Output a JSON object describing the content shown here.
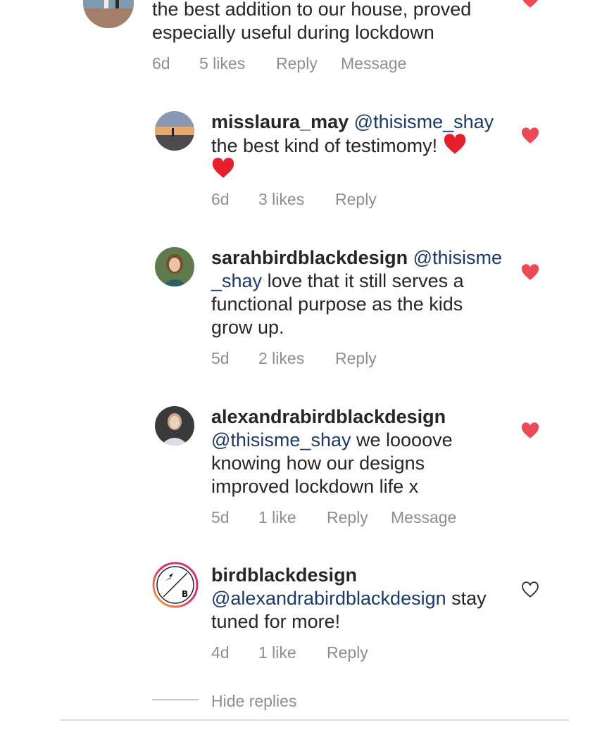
{
  "top_comment": {
    "text": "the best addition to our house, proved especially useful during lockdown",
    "time": "6d",
    "likes": "5 likes",
    "reply": "Reply",
    "message": "Message"
  },
  "replies": [
    {
      "username": "misslaura_may",
      "mention": "@thisisme_shay",
      "text": "the best kind of testimomy!",
      "time": "6d",
      "likes": "3 likes",
      "reply": "Reply",
      "liked": true
    },
    {
      "username": "sarahbirdblackdesign",
      "mention_part1": "@thisisme",
      "mention_part2": "_shay",
      "text_line1": "love that it still serves a",
      "text_line2": "functional purpose as the kids",
      "text_line3": "grow up.",
      "time": "5d",
      "likes": "2 likes",
      "reply": "Reply",
      "liked": true
    },
    {
      "username": "alexandrabirdblackdesign",
      "mention": "@thisisme_shay",
      "text_line1": "we loooove",
      "text_line2": "knowing how our designs",
      "text_line3": "improved lockdown life x",
      "time": "5d",
      "likes": "1 like",
      "reply": "Reply",
      "message": "Message",
      "liked": true
    },
    {
      "username": "birdblackdesign",
      "mention": "@alexandrabirdblackdesign",
      "text_line1": "stay",
      "text_line2": "tuned for more!",
      "time": "4d",
      "likes": "1 like",
      "reply": "Reply",
      "liked": false,
      "avatar_letter": "B"
    }
  ],
  "hide_replies": "Hide replies",
  "colors": {
    "heart": "#ed4956",
    "mention": "#1b3a6b",
    "meta": "#8e8e8e"
  }
}
